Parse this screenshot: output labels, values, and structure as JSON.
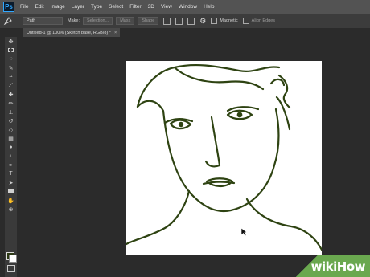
{
  "app": {
    "logo": "Ps"
  },
  "menu": [
    "File",
    "Edit",
    "Image",
    "Layer",
    "Type",
    "Select",
    "Filter",
    "3D",
    "View",
    "Window",
    "Help"
  ],
  "options_bar": {
    "mode": "Path",
    "make_label": "Make:",
    "selection_btn": "Selection...",
    "mask_btn": "Mask",
    "shape_btn": "Shape",
    "magnetic_label": "Magnetic",
    "align_edges_label": "Align Edges"
  },
  "document": {
    "tab_title": "Untitled-1 @ 100% (Sketch base, RGB/8) *",
    "close": "×"
  },
  "tools": [
    "move",
    "marquee",
    "lasso",
    "quick-select",
    "crop",
    "eyedropper",
    "healing",
    "brush",
    "clone-stamp",
    "history-brush",
    "eraser",
    "gradient",
    "blur",
    "dodge",
    "pen",
    "type",
    "path-select",
    "shape",
    "hand",
    "zoom"
  ],
  "colors": {
    "foreground": "#2d3a15",
    "background": "#ffffff",
    "stroke": "#2e4312"
  },
  "watermark": {
    "text": "wikiHow"
  }
}
